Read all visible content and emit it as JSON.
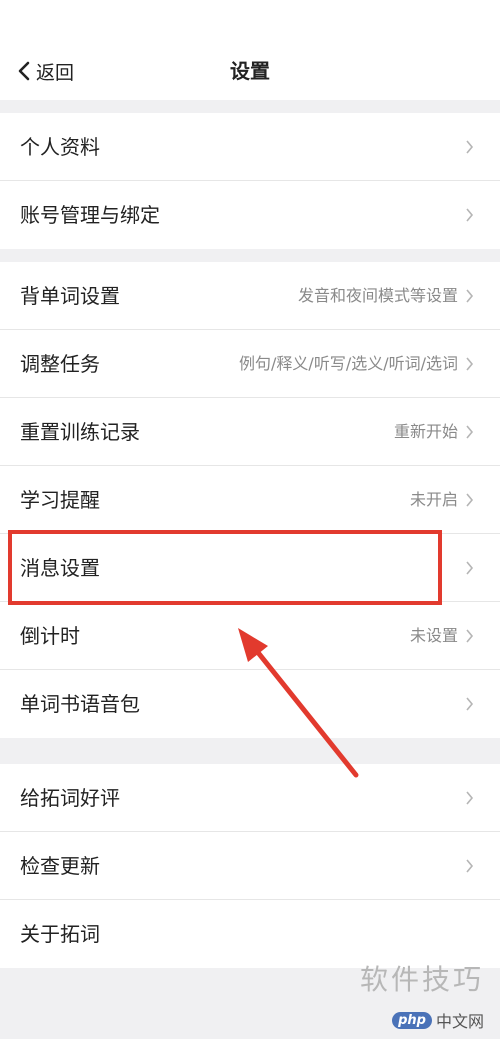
{
  "nav": {
    "back_label": "返回",
    "title": "设置"
  },
  "groups": [
    {
      "rows": [
        {
          "label": "个人资料",
          "value": ""
        },
        {
          "label": "账号管理与绑定",
          "value": ""
        }
      ]
    },
    {
      "rows": [
        {
          "label": "背单词设置",
          "value": "发音和夜间模式等设置"
        },
        {
          "label": "调整任务",
          "value": "例句/释义/听写/选义/听词/选词"
        },
        {
          "label": "重置训练记录",
          "value": "重新开始"
        },
        {
          "label": "学习提醒",
          "value": "未开启"
        },
        {
          "label": "消息设置",
          "value": ""
        },
        {
          "label": "倒计时",
          "value": "未设置"
        },
        {
          "label": "单词书语音包",
          "value": ""
        }
      ]
    },
    {
      "rows": [
        {
          "label": "给拓词好评",
          "value": ""
        },
        {
          "label": "检查更新",
          "value": ""
        },
        {
          "label": "关于拓词",
          "value": ""
        }
      ]
    }
  ],
  "annotation": {
    "highlight_color": "#e23a2e",
    "arrow_color": "#e23a2e"
  },
  "watermark": {
    "text": "软件技巧",
    "logo_badge": "php",
    "logo_text": "中文网"
  }
}
